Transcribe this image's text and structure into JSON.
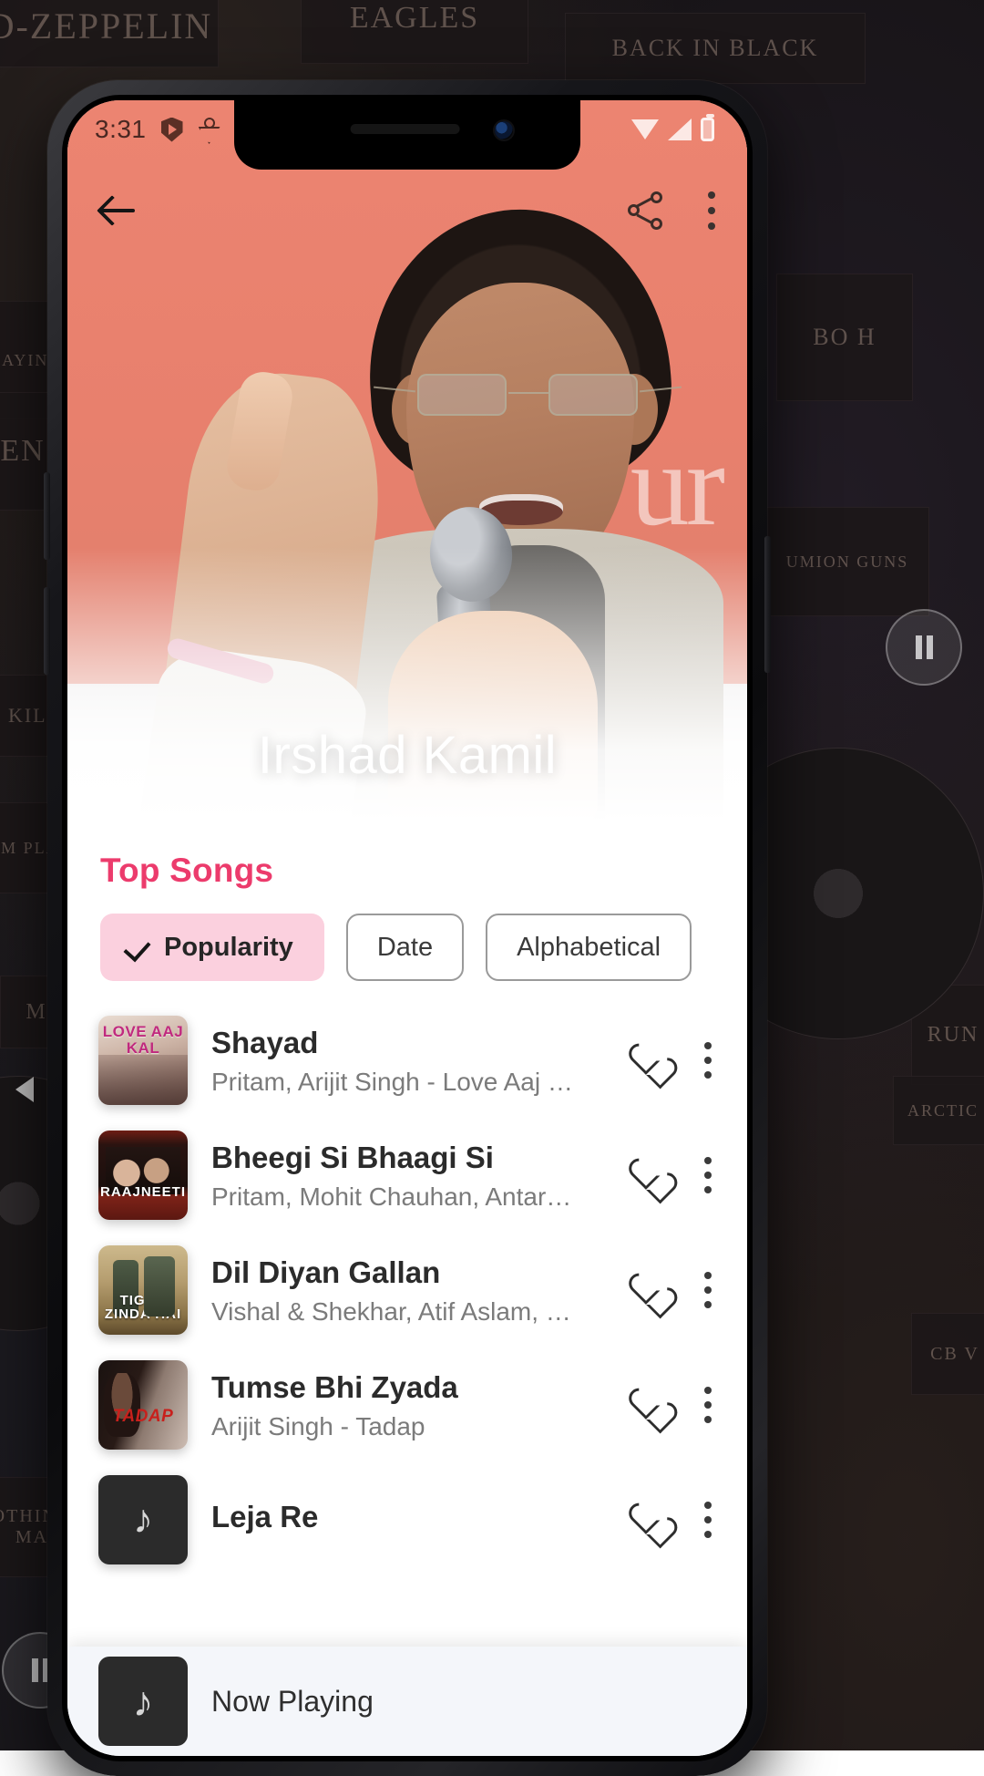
{
  "statusbar": {
    "time": "3:31",
    "left_icons": [
      "shield-play-icon",
      "kite-icon"
    ],
    "right_icons": [
      "wifi-icon",
      "signal-icon",
      "battery-icon"
    ]
  },
  "toolbar": {
    "back_icon": "back-arrow-icon",
    "share_icon": "share-icon",
    "more_icon": "overflow-menu-icon"
  },
  "hero": {
    "artist_name": "Irshad Kamil",
    "wall_text": "ur"
  },
  "section": {
    "title": "Top Songs",
    "accent_color": "#ec3b6c"
  },
  "chips": [
    {
      "label": "Popularity",
      "selected": true,
      "check_icon": "check-icon"
    },
    {
      "label": "Date",
      "selected": false
    },
    {
      "label": "Alphabetical",
      "selected": false
    }
  ],
  "songs": [
    {
      "title": "Shayad",
      "subtitle": "Pritam, Arijit Singh - Love Aaj …",
      "cover_label": "LOVE AAJ KAL",
      "cover_style": "cv-love",
      "favorite_icon": "heart-outline-icon",
      "menu_icon": "overflow-menu-icon"
    },
    {
      "title": "Bheegi Si Bhaagi Si",
      "subtitle": "Pritam, Mohit Chauhan, Antar…",
      "cover_label": "RAAJNEETI",
      "cover_style": "cv-raaj",
      "favorite_icon": "heart-outline-icon",
      "menu_icon": "overflow-menu-icon"
    },
    {
      "title": "Dil Diyan Gallan",
      "subtitle": "Vishal & Shekhar, Atif Aslam, …",
      "cover_label": "TIGER ZINDA HAI",
      "cover_style": "cv-tiger",
      "favorite_icon": "heart-outline-icon",
      "menu_icon": "overflow-menu-icon"
    },
    {
      "title": "Tumse Bhi Zyada",
      "subtitle": "Arijit Singh - Tadap",
      "cover_label": "TADAP",
      "cover_style": "cv-tadap",
      "favorite_icon": "heart-outline-icon",
      "menu_icon": "overflow-menu-icon"
    },
    {
      "title": "Leja Re",
      "subtitle": "",
      "cover_label": "",
      "cover_style": "cv-dark",
      "favorite_icon": "heart-outline-icon",
      "menu_icon": "overflow-menu-icon"
    }
  ],
  "nowplaying": {
    "label": "Now Playing",
    "thumb_icon": "music-note-icon"
  },
  "backdrop": {
    "tiles": [
      "D-ZEPPELIN",
      "EAGLES",
      "BACK IN BLACK",
      "PLAYING F",
      "EN",
      "Kill",
      "BO H",
      "umion Guns",
      "RUN",
      "Arctic",
      "M PLAY",
      "CB V",
      "othing Ma",
      "M"
    ]
  }
}
